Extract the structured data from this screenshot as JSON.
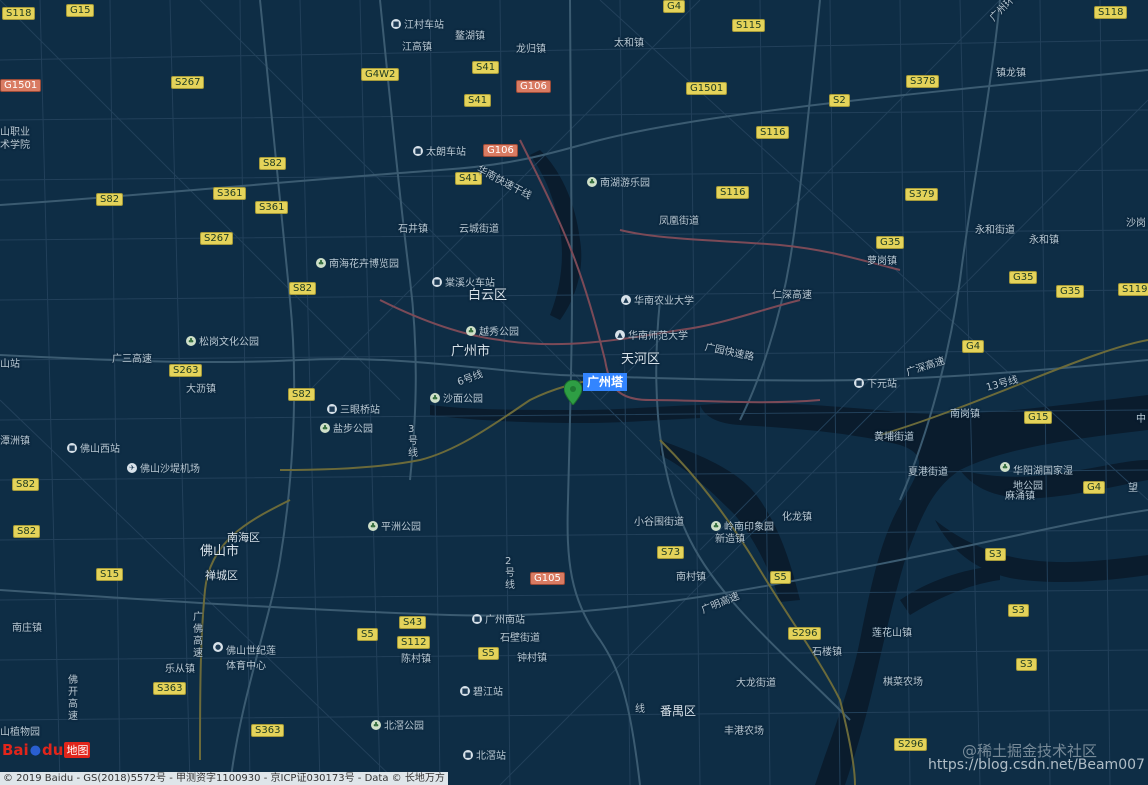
{
  "map": {
    "colors": {
      "background": "#0e2d45",
      "road": "#27465d",
      "major_road": "#3d5d73",
      "river": "#0a1b2b",
      "metro": "#7a4a56",
      "metro2": "#6f6c3a"
    },
    "marker": {
      "label": "广州塔",
      "icon": "location-pin-icon",
      "color": "#2e9e44"
    },
    "districts": [
      {
        "text": "白云区"
      },
      {
        "text": "广州市"
      },
      {
        "text": "天河区"
      },
      {
        "text": "佛山市"
      },
      {
        "text": "南海区"
      },
      {
        "text": "禅城区"
      },
      {
        "text": "番禺区"
      }
    ],
    "place_labels": [
      {
        "text": "江高镇"
      },
      {
        "text": "鳌湖镇"
      },
      {
        "text": "龙归镇"
      },
      {
        "text": "太和镇"
      },
      {
        "text": "镇龙镇"
      },
      {
        "text": "石井镇"
      },
      {
        "text": "云城街道"
      },
      {
        "text": "凤凰街道"
      },
      {
        "text": "永和街道"
      },
      {
        "text": "永和镇"
      },
      {
        "text": "萝岗镇"
      },
      {
        "text": "大沥镇"
      },
      {
        "text": "黄埔街道"
      },
      {
        "text": "南岗镇"
      },
      {
        "text": "夏港街道"
      },
      {
        "text": "麻涌镇"
      },
      {
        "text": "小谷围街道"
      },
      {
        "text": "化龙镇"
      },
      {
        "text": "新造镇"
      },
      {
        "text": "南村镇"
      },
      {
        "text": "石壁街道"
      },
      {
        "text": "钟村镇"
      },
      {
        "text": "陈村镇"
      },
      {
        "text": "乐从镇"
      },
      {
        "text": "大龙街道"
      },
      {
        "text": "石楼镇"
      },
      {
        "text": "莲花山镇"
      },
      {
        "text": "潭洲镇"
      },
      {
        "text": "南庄镇"
      },
      {
        "text": "丰港农场"
      },
      {
        "text": "棋菜农场"
      },
      {
        "text": "沙岗"
      },
      {
        "text": "山职业"
      },
      {
        "text": "术学院"
      },
      {
        "text": "山站"
      },
      {
        "text": "山植物园"
      },
      {
        "text": "中"
      },
      {
        "text": "望"
      }
    ],
    "pois": [
      {
        "text": "江村车站",
        "icon": "train-station-icon"
      },
      {
        "text": "太朗车站",
        "icon": "train-station-icon"
      },
      {
        "text": "南湖游乐园",
        "icon": "park-icon"
      },
      {
        "text": "南海花卉博览园",
        "icon": "park-icon"
      },
      {
        "text": "棠溪火车站",
        "icon": "train-station-icon"
      },
      {
        "text": "华南农业大学",
        "icon": "university-icon"
      },
      {
        "text": "越秀公园",
        "icon": "park-icon"
      },
      {
        "text": "华南师范大学",
        "icon": "university-icon"
      },
      {
        "text": "松岗文化公园",
        "icon": "park-icon"
      },
      {
        "text": "沙面公园",
        "icon": "park-icon"
      },
      {
        "text": "三眼桥站",
        "icon": "train-station-icon"
      },
      {
        "text": "盐步公园",
        "icon": "park-icon"
      },
      {
        "text": "佛山西站",
        "icon": "train-station-icon"
      },
      {
        "text": "佛山沙堤机场",
        "icon": "airport-icon"
      },
      {
        "text": "下元站",
        "icon": "train-station-icon"
      },
      {
        "text": "华阳湖国家湿地公园",
        "icon": "park-icon"
      },
      {
        "text": "平洲公园",
        "icon": "park-icon"
      },
      {
        "text": "岭南印象园",
        "icon": "park-icon"
      },
      {
        "text": "广州南站",
        "icon": "train-station-icon"
      },
      {
        "text": "佛山世纪莲体育中心",
        "icon": "stadium-icon"
      },
      {
        "text": "碧江站",
        "icon": "train-station-icon"
      },
      {
        "text": "北滘公园",
        "icon": "park-icon"
      },
      {
        "text": "北滘站",
        "icon": "train-station-icon"
      }
    ],
    "road_names": [
      {
        "text": "华南快速干线"
      },
      {
        "text": "6号线"
      },
      {
        "text": "广园快速路"
      },
      {
        "text": "仁深高速"
      },
      {
        "text": "广深高速"
      },
      {
        "text": "13号线"
      },
      {
        "text": "广三高速"
      },
      {
        "text": "广州环城高速"
      },
      {
        "text": "2号线"
      },
      {
        "text": "广明高速"
      },
      {
        "text": "3号线"
      },
      {
        "text": "广佛高速"
      },
      {
        "text": "佛开高速"
      },
      {
        "text": "线"
      }
    ],
    "shields": [
      {
        "text": "S118",
        "style": "y"
      },
      {
        "text": "G15",
        "style": "y"
      },
      {
        "text": "G4",
        "style": "y"
      },
      {
        "text": "S115",
        "style": "y"
      },
      {
        "text": "S118",
        "style": "y"
      },
      {
        "text": "G1501",
        "style": "r"
      },
      {
        "text": "S267",
        "style": "y"
      },
      {
        "text": "G4W2",
        "style": "y"
      },
      {
        "text": "S41",
        "style": "y"
      },
      {
        "text": "G106",
        "style": "r"
      },
      {
        "text": "G1501",
        "style": "y"
      },
      {
        "text": "S378",
        "style": "y"
      },
      {
        "text": "S2",
        "style": "y"
      },
      {
        "text": "S41",
        "style": "y"
      },
      {
        "text": "S116",
        "style": "y"
      },
      {
        "text": "G106",
        "style": "r"
      },
      {
        "text": "S82",
        "style": "y"
      },
      {
        "text": "S41",
        "style": "y"
      },
      {
        "text": "S361",
        "style": "y"
      },
      {
        "text": "S82",
        "style": "y"
      },
      {
        "text": "S361",
        "style": "y"
      },
      {
        "text": "S116",
        "style": "y"
      },
      {
        "text": "S379",
        "style": "y"
      },
      {
        "text": "S267",
        "style": "y"
      },
      {
        "text": "G35",
        "style": "y"
      },
      {
        "text": "S82",
        "style": "y"
      },
      {
        "text": "G35",
        "style": "y"
      },
      {
        "text": "G35",
        "style": "y"
      },
      {
        "text": "S119",
        "style": "y"
      },
      {
        "text": "S263",
        "style": "y"
      },
      {
        "text": "G4",
        "style": "y"
      },
      {
        "text": "S82",
        "style": "y"
      },
      {
        "text": "G15",
        "style": "y"
      },
      {
        "text": "S82",
        "style": "y"
      },
      {
        "text": "G4",
        "style": "y"
      },
      {
        "text": "S82",
        "style": "y"
      },
      {
        "text": "S73",
        "style": "y"
      },
      {
        "text": "S3",
        "style": "y"
      },
      {
        "text": "S15",
        "style": "y"
      },
      {
        "text": "G105",
        "style": "r"
      },
      {
        "text": "S5",
        "style": "y"
      },
      {
        "text": "S43",
        "style": "y"
      },
      {
        "text": "S3",
        "style": "y"
      },
      {
        "text": "S5",
        "style": "y"
      },
      {
        "text": "S112",
        "style": "y"
      },
      {
        "text": "S296",
        "style": "y"
      },
      {
        "text": "S5",
        "style": "y"
      },
      {
        "text": "S3",
        "style": "y"
      },
      {
        "text": "S363",
        "style": "y"
      },
      {
        "text": "S363",
        "style": "y"
      },
      {
        "text": "S296",
        "style": "y"
      }
    ]
  },
  "footer": {
    "logo_text_a": "Bai",
    "logo_text_b": "du",
    "logo_map": "地图",
    "copyright": "© 2019 Baidu - GS(2018)5572号 - 甲测资字1100930 - 京ICP证030173号 - Data © 长地万方",
    "watermark_1": "@稀土掘金技术社区",
    "watermark_2": "https://blog.csdn.net/Beam007"
  }
}
